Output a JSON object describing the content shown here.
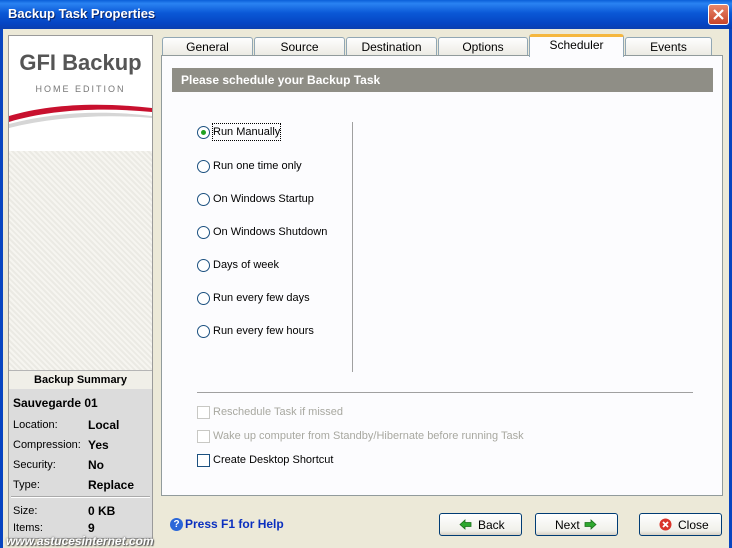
{
  "window": {
    "title": "Backup Task Properties"
  },
  "logo": {
    "main": "GFI Backup",
    "sub": "HOME EDITION"
  },
  "summary": {
    "header": "Backup Summary",
    "name": "Sauvegarde 01",
    "rows": [
      {
        "label": "Location:",
        "value": "Local"
      },
      {
        "label": "Compression:",
        "value": "Yes"
      },
      {
        "label": "Security:",
        "value": "No"
      },
      {
        "label": "Type:",
        "value": "Replace"
      },
      {
        "label": "Size:",
        "value": "0 KB"
      },
      {
        "label": "Items:",
        "value": "9"
      }
    ]
  },
  "tabs": [
    "General",
    "Source",
    "Destination",
    "Options",
    "Scheduler",
    "Events"
  ],
  "active_tab": "Scheduler",
  "panel": {
    "header": "Please schedule your Backup Task"
  },
  "schedule_options": [
    {
      "label": "Run Manually",
      "selected": true
    },
    {
      "label": "Run one time only",
      "selected": false
    },
    {
      "label": "On Windows Startup",
      "selected": false
    },
    {
      "label": "On Windows Shutdown",
      "selected": false
    },
    {
      "label": "Days of week",
      "selected": false
    },
    {
      "label": "Run every few days",
      "selected": false
    },
    {
      "label": "Run every few hours",
      "selected": false
    }
  ],
  "checkboxes": [
    {
      "label": "Reschedule Task if missed",
      "checked": false,
      "enabled": false
    },
    {
      "label": "Wake up computer from Standby/Hibernate before running Task",
      "checked": false,
      "enabled": false
    },
    {
      "label": "Create Desktop Shortcut",
      "checked": false,
      "enabled": true
    }
  ],
  "help": {
    "label": "Press F1 for Help"
  },
  "buttons": {
    "back": "Back",
    "next": "Next",
    "close": "Close"
  },
  "watermark": "www.astucesinternet.com",
  "colors": {
    "titlebar": "#0a58d6",
    "active_tab_accent": "#f5b73f",
    "header_bar": "#8f8e86",
    "help_link": "#0a2fbf"
  }
}
